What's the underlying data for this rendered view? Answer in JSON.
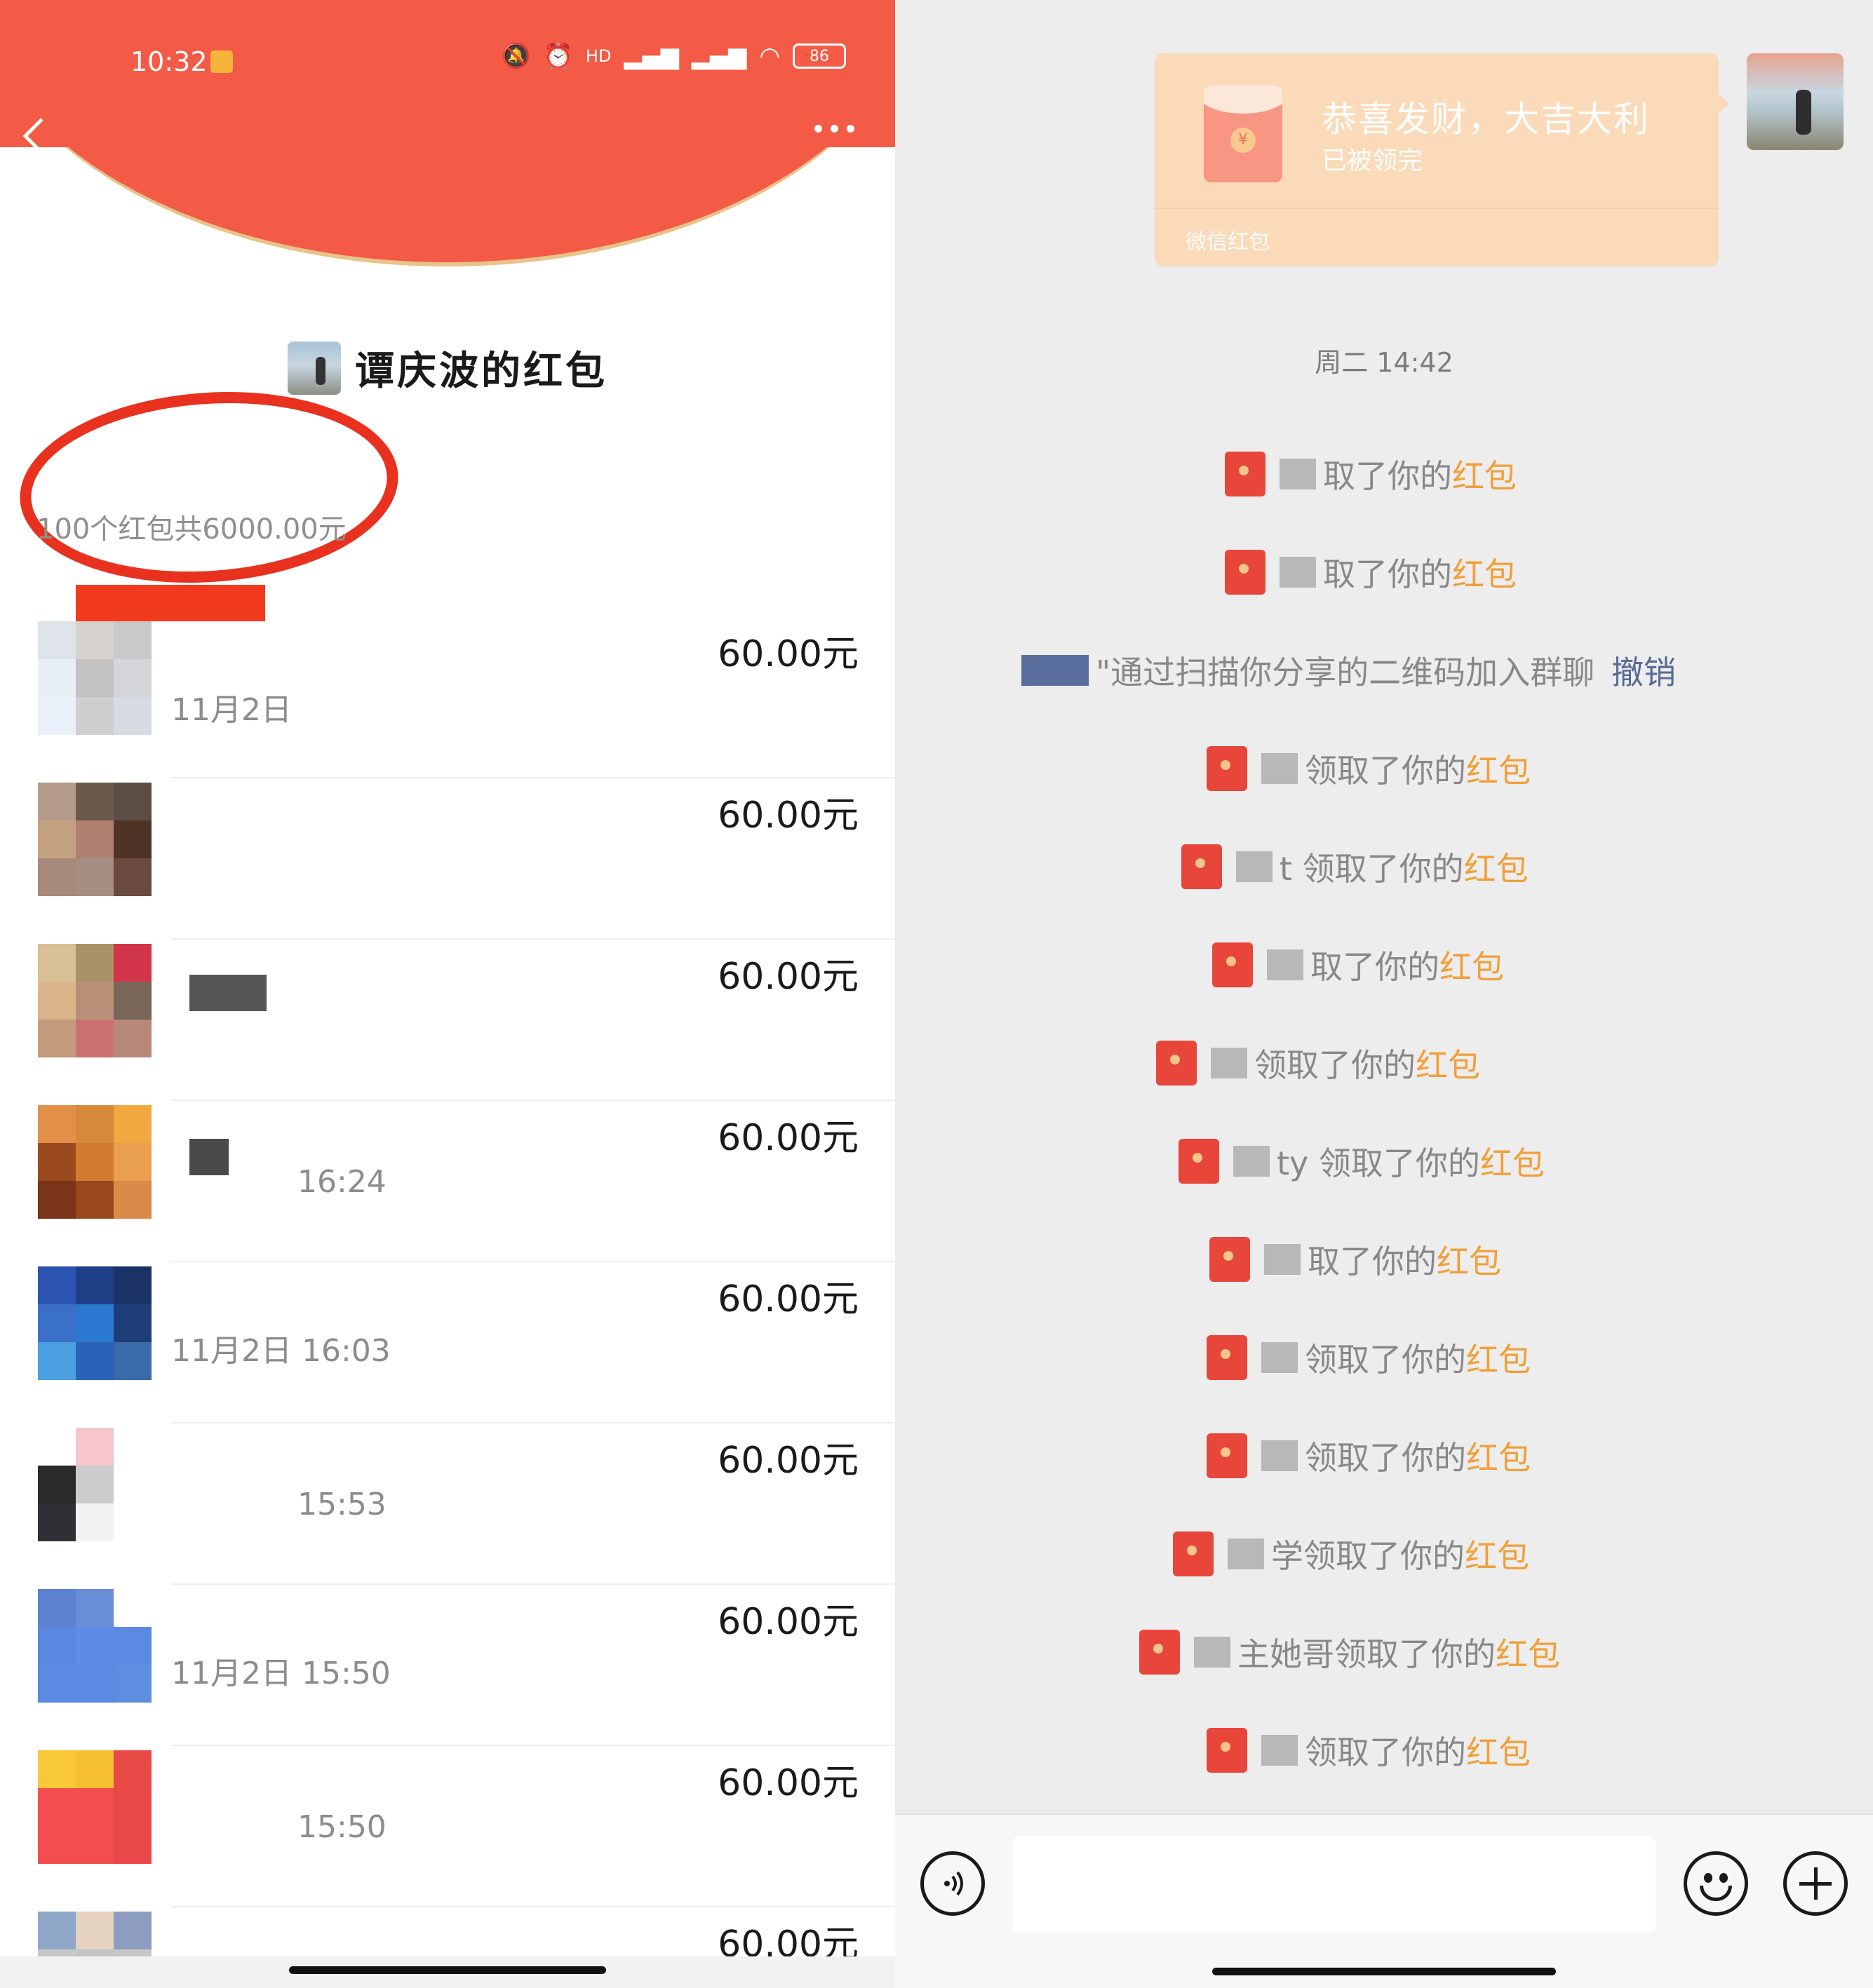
{
  "status_bar": {
    "time": "10:32",
    "battery": "86",
    "hd": "HD"
  },
  "header": {
    "back_icon": "chevron-left-icon",
    "more_icon": "more-dots-icon"
  },
  "sender": {
    "title": "谭庆波的红包"
  },
  "summary": "100个红包共6000.00元",
  "records": [
    {
      "name": "",
      "time": "11月2日",
      "amount": "60.00元"
    },
    {
      "name": "",
      "time": "",
      "amount": "60.00元"
    },
    {
      "name": "",
      "time": "",
      "amount": "60.00元"
    },
    {
      "name": "",
      "time": "16:24",
      "amount": "60.00元"
    },
    {
      "name": "",
      "time": "11月2日  16:03",
      "amount": "60.00元"
    },
    {
      "name": "",
      "time": "15:53",
      "amount": "60.00元"
    },
    {
      "name": "",
      "time": "11月2日  15:50",
      "amount": "60.00元"
    },
    {
      "name": "",
      "time": "15:50",
      "amount": "60.00元"
    },
    {
      "name": "",
      "time": "",
      "amount": "60.00元"
    }
  ],
  "red_packet_card": {
    "title": "恭喜发财，大吉大利",
    "status": "已被领完",
    "footer": "微信红包"
  },
  "chat": {
    "timestamp": "周二 14:42",
    "hongbao_word": "红包",
    "messages": [
      {
        "prefix": "取了你的",
        "type": "claim"
      },
      {
        "prefix": "取了你的",
        "type": "claim"
      },
      {
        "prefix": "\"通过扫描你分享的二维码加入群聊",
        "type": "join",
        "action": "撤销"
      },
      {
        "prefix": "领取了你的",
        "type": "claim"
      },
      {
        "prefix": "t 领取了你的",
        "type": "claim"
      },
      {
        "prefix": "取了你的",
        "type": "claim"
      },
      {
        "prefix": "领取了你的",
        "type": "claim"
      },
      {
        "prefix": "ty 领取了你的",
        "type": "claim"
      },
      {
        "prefix": "取了你的",
        "type": "claim"
      },
      {
        "prefix": "领取了你的",
        "type": "claim"
      },
      {
        "prefix": "领取了你的",
        "type": "claim"
      },
      {
        "prefix": "学领取了你的",
        "type": "claim"
      },
      {
        "prefix": "主她哥领取了你的",
        "type": "claim"
      },
      {
        "prefix": "领取了你的",
        "type": "claim"
      }
    ]
  },
  "input_bar": {
    "voice_icon": "voice-icon",
    "emoji_icon": "emoji-icon",
    "plus_icon": "plus-icon",
    "placeholder": ""
  },
  "colors": {
    "header_red": "#f35b46",
    "circle_mark": "#e8321f",
    "hongbao_orange": "#f0a03a",
    "link_blue": "#576b95",
    "card_bg": "#fbdab9"
  }
}
